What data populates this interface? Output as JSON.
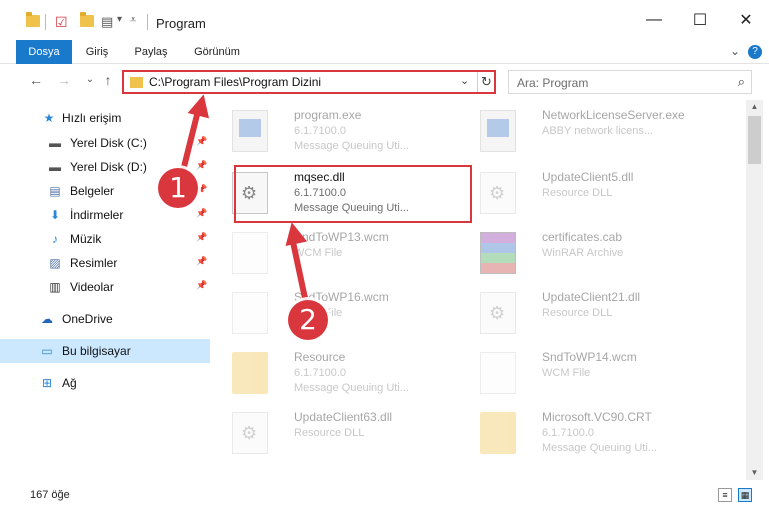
{
  "window": {
    "title": "Program",
    "controls": {
      "minimize": "—",
      "maximize": "☐",
      "close": "✕"
    }
  },
  "ribbon": {
    "tabs": [
      {
        "label": "Dosya",
        "active": true
      },
      {
        "label": "Giriş",
        "active": false
      },
      {
        "label": "Paylaş",
        "active": false
      },
      {
        "label": "Görünüm",
        "active": false
      }
    ],
    "expand_icon": "chevron-down-icon",
    "help_icon": "help-icon",
    "expand_glyph": "⌄",
    "help_glyph": "?"
  },
  "nav": {
    "back_glyph": "←",
    "forward_glyph": "→",
    "recent_glyph": "⌄",
    "up_glyph": "↑"
  },
  "address": {
    "path": "C:\\Program Files\\Program Dizini",
    "dropdown_glyph": "⌄",
    "refresh_glyph": "↻"
  },
  "search": {
    "placeholder": "Ara: Program",
    "icon_glyph": "⌕"
  },
  "sidebar": {
    "items": [
      {
        "label": "Hızlı erişim",
        "icon": "star-icon",
        "glyph": "★",
        "color": "#2b86d8"
      },
      {
        "label": "Yerel Disk (C:)",
        "icon": "drive-icon",
        "glyph": "▬",
        "color": "#555555",
        "pinned": true
      },
      {
        "label": "Yerel Disk (D:)",
        "icon": "drive-icon",
        "glyph": "▬",
        "color": "#555555",
        "pinned": true
      },
      {
        "label": "Belgeler",
        "icon": "document-icon",
        "glyph": "▤",
        "color": "#4d6fa3",
        "pinned": true
      },
      {
        "label": "İndirmeler",
        "icon": "download-icon",
        "glyph": "⬇",
        "color": "#2b86d8",
        "pinned": true
      },
      {
        "label": "Müzik",
        "icon": "music-icon",
        "glyph": "♪",
        "color": "#2b86d8",
        "pinned": true
      },
      {
        "label": "Resimler",
        "icon": "pictures-icon",
        "glyph": "▨",
        "color": "#4d6fa3",
        "pinned": true
      },
      {
        "label": "Videolar",
        "icon": "video-icon",
        "glyph": "▥",
        "color": "#333333",
        "pinned": true
      },
      {
        "label": "OneDrive",
        "icon": "cloud-icon",
        "glyph": "☁",
        "color": "#2166b8"
      },
      {
        "label": "Bu bilgisayar",
        "icon": "computer-icon",
        "glyph": "▭",
        "color": "#2b86d8",
        "selected": true
      },
      {
        "label": "Ağ",
        "icon": "network-icon",
        "glyph": "⊞",
        "color": "#2b86d8"
      }
    ],
    "pin_glyph": "📌"
  },
  "files": [
    {
      "name": "program.exe",
      "line2": "6.1.7100.0",
      "line3": "Message Queuing Uti...",
      "icon": "exe-icon",
      "faded": true
    },
    {
      "name": "NetworkLicenseServer.exe",
      "line2": "ABBY network licens...",
      "line3": "",
      "icon": "exe-icon",
      "faded": true
    },
    {
      "name": "mqsec.dll",
      "line2": "6.1.7100.0",
      "line3": "Message Queuing Uti...",
      "icon": "dll-icon",
      "faded": false
    },
    {
      "name": "UpdateClient5.dll",
      "line2": "Resource DLL",
      "line3": "",
      "icon": "dll-icon",
      "faded": true
    },
    {
      "name": "SndToWP13.wcm",
      "line2": "WCM File",
      "line3": "",
      "icon": "wcm-icon",
      "faded": true
    },
    {
      "name": "certificates.cab",
      "line2": "WinRAR Archive",
      "line3": "",
      "icon": "archive-icon",
      "faded": true
    },
    {
      "name": "SndToWP16.wcm",
      "line2": "WCM File",
      "line3": "",
      "icon": "wcm-icon",
      "faded": true
    },
    {
      "name": "UpdateClient21.dll",
      "line2": "Resource DLL",
      "line3": "",
      "icon": "dll-icon",
      "faded": true
    },
    {
      "name": "Resource",
      "line2": "6.1.7100.0",
      "line3": "Message Queuing Uti...",
      "icon": "folder-icon",
      "faded": true
    },
    {
      "name": "SndToWP14.wcm",
      "line2": "WCM File",
      "line3": "",
      "icon": "wcm-icon",
      "faded": true
    },
    {
      "name": "UpdateClient63.dll",
      "line2": "Resource DLL",
      "line3": "",
      "icon": "dll-icon",
      "faded": true
    },
    {
      "name": "Microsoft.VC90.CRT",
      "line2": "6.1.7100.0",
      "line3": "Message Queuing Uti...",
      "icon": "folder-icon",
      "faded": true
    }
  ],
  "status": {
    "count": "167 öğe"
  },
  "annotations": {
    "step1": "1",
    "step2": "2",
    "color": "#d9363e"
  }
}
